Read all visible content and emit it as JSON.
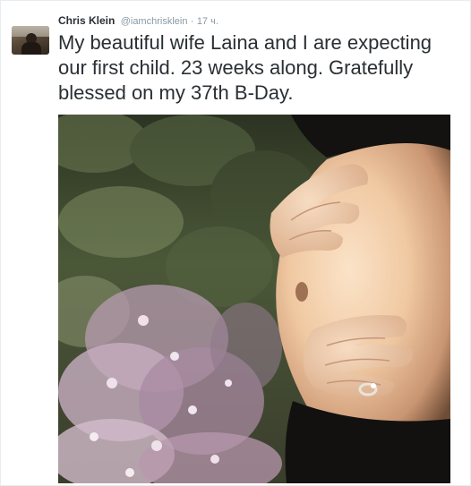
{
  "tweet": {
    "author_name": "Chris Klein",
    "author_handle": "@iamchrisklein",
    "separator": "·",
    "time": "17 ч.",
    "text": "My beautiful wife Laina and I are expecting our first child. 23 weeks along. Gratefully blessed on my 37th B-Day."
  },
  "colors": {
    "name": "#292f33",
    "meta": "#8899a6",
    "border": "#e6ecf0"
  }
}
